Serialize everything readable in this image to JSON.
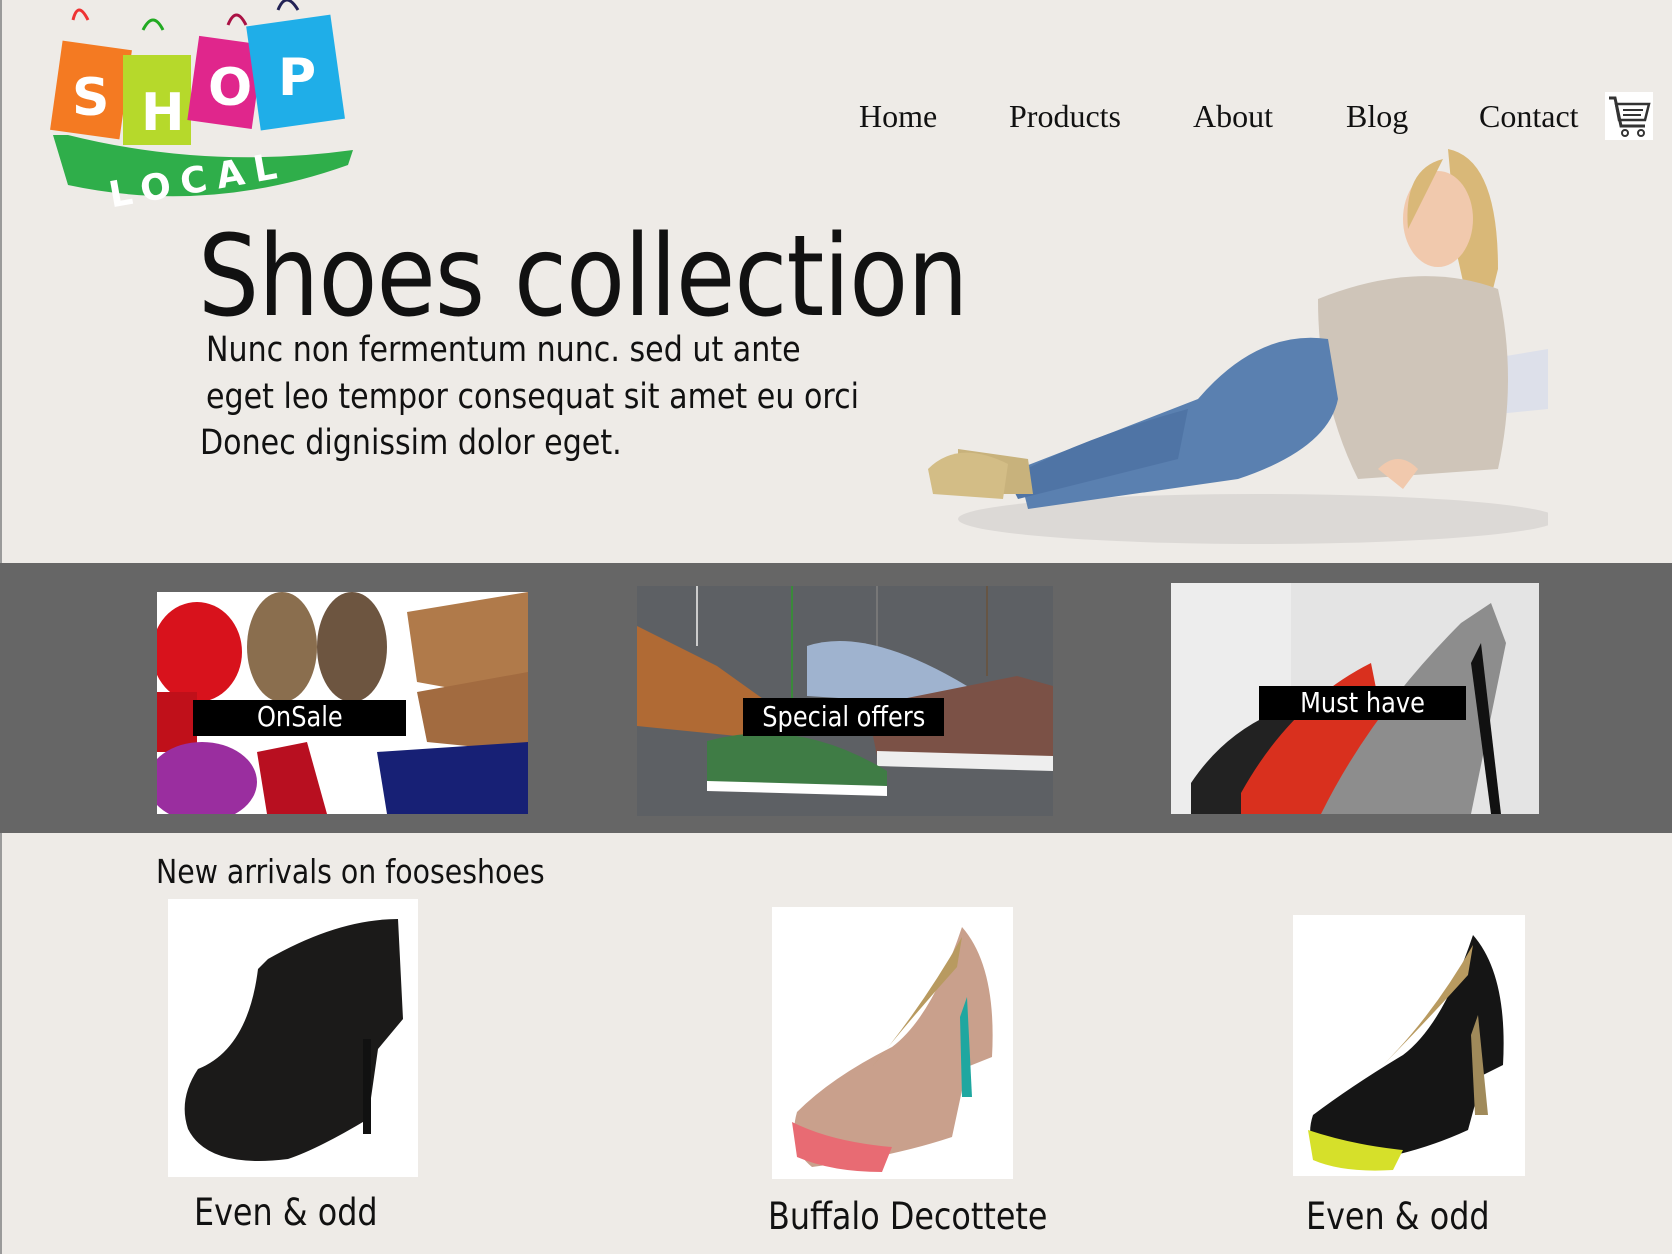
{
  "logo": {
    "text_top": "SHOP",
    "text_bottom": "LOCAL"
  },
  "nav": {
    "items": [
      "Home",
      "Products",
      "About",
      "Blog",
      "Contact"
    ],
    "cart_icon": "shopping-cart-icon"
  },
  "hero": {
    "title": "Shoes collection",
    "lines": [
      "Nunc non fermentum nunc. sed ut ante",
      "eget leo tempor consequat sit amet eu orci",
      "Donec dignissim dolor eget."
    ]
  },
  "categories": [
    {
      "label": "OnSale"
    },
    {
      "label": "Special offers"
    },
    {
      "label": "Must have"
    }
  ],
  "arrivals": {
    "heading": "New arrivals on fooseshoes",
    "products": [
      {
        "name": "Even & odd"
      },
      {
        "name": "Buffalo Decottete"
      },
      {
        "name": "Even & odd"
      }
    ]
  },
  "colors": {
    "background": "#eeebe7",
    "band": "#666666",
    "tag": "#000000"
  }
}
